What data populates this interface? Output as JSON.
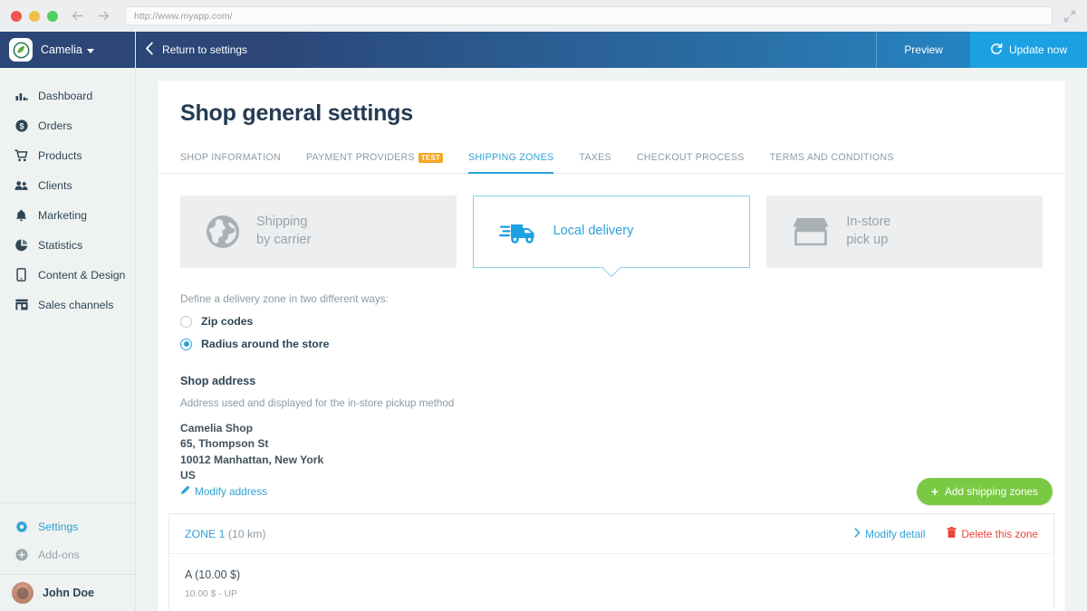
{
  "browser": {
    "url": "http://www.myapp.com/",
    "back_icon": "back-arrow-icon",
    "forward_icon": "forward-arrow-icon",
    "expand_icon": "expand-icon"
  },
  "brand": {
    "name": "Camelia",
    "logo_icon": "camelia-leaf-logo"
  },
  "topbar": {
    "return_label": "Return to settings",
    "preview_label": "Preview",
    "update_label": "Update now",
    "update_icon": "refresh-icon",
    "back_icon": "chevron-left-icon"
  },
  "sidebar": {
    "items": [
      {
        "label": "Dashboard",
        "icon": "bar-chart-icon"
      },
      {
        "label": "Orders",
        "icon": "dollar-circle-icon"
      },
      {
        "label": "Products",
        "icon": "shopping-cart-icon"
      },
      {
        "label": "Clients",
        "icon": "people-icon"
      },
      {
        "label": "Marketing",
        "icon": "bell-icon"
      },
      {
        "label": "Statistics",
        "icon": "pie-chart-icon"
      },
      {
        "label": "Content & Design",
        "icon": "mobile-phone-icon"
      },
      {
        "label": "Sales channels",
        "icon": "storefront-icon"
      }
    ],
    "bottom_items": [
      {
        "label": "Settings",
        "icon": "gear-icon"
      },
      {
        "label": "Add-ons",
        "icon": "plus-circle-icon"
      }
    ],
    "user": {
      "name": "John Doe",
      "avatar": "user-avatar"
    }
  },
  "main": {
    "page_title": "Shop general settings",
    "tabs": [
      {
        "label": "SHOP INFORMATION",
        "active": false
      },
      {
        "label": "PAYMENT PROVIDERS",
        "badge": "TEST",
        "active": false
      },
      {
        "label": "SHIPPING ZONES",
        "active": true
      },
      {
        "label": "TAXES",
        "active": false
      },
      {
        "label": "CHECKOUT PROCESS",
        "active": false
      },
      {
        "label": "TERMS AND CONDITIONS",
        "active": false
      }
    ],
    "methods": [
      {
        "line1": "Shipping",
        "line2": "by carrier",
        "icon": "globe-icon",
        "selected": false
      },
      {
        "line1": "Local delivery",
        "line2": "",
        "icon": "delivery-truck-icon",
        "selected": true
      },
      {
        "line1": "In-store",
        "line2": "pick up",
        "icon": "storefront-icon",
        "selected": false
      }
    ],
    "zone_hint": "Define a delivery zone in two different ways:",
    "zone_options": [
      {
        "label": "Zip codes",
        "selected": false
      },
      {
        "label": "Radius around the store",
        "selected": true
      }
    ],
    "address_heading": "Shop address",
    "address_note": "Address used and displayed for the in-store pickup method",
    "address_lines": [
      "Camelia Shop",
      "65, Thompson St",
      "10012 Manhattan, New York",
      "US"
    ],
    "modify_address_label": "Modify address",
    "modify_address_icon": "pencil-icon",
    "add_zone_label": "Add shipping zones",
    "add_zone_icon": "plus-icon",
    "zone": {
      "name": "ZONE 1",
      "radius": "(10 km)",
      "modify_label": "Modify detail",
      "modify_icon": "chevron-right-icon",
      "delete_label": "Delete this zone",
      "delete_icon": "trash-icon",
      "item_title": "A (10.00 $)",
      "item_sub": "10.00 $ - UP"
    }
  },
  "colors": {
    "accent_blue": "#2ea2d6",
    "brand_navy": "#2b4677",
    "green": "#7ac943",
    "orange": "#f6a623",
    "red": "#e8453c"
  }
}
